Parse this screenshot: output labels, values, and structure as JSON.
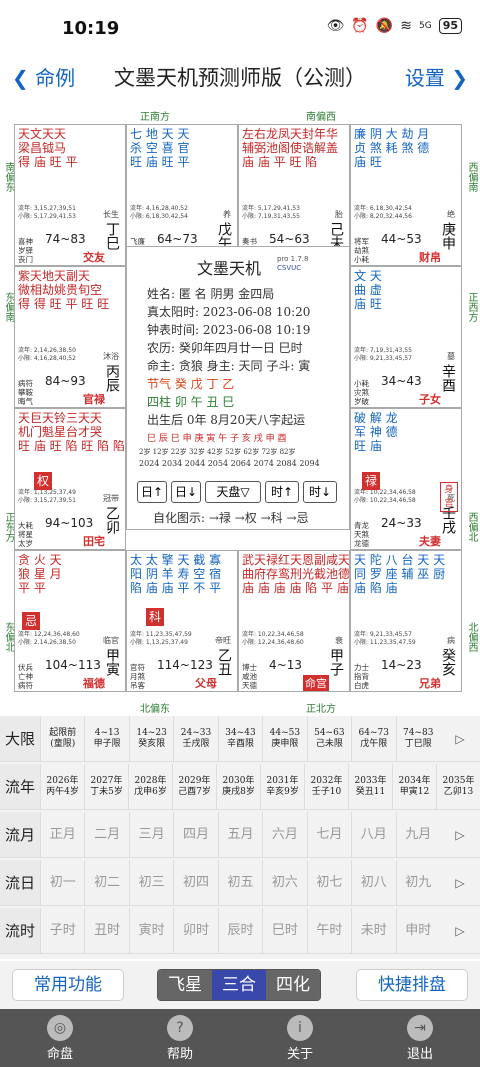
{
  "status": {
    "time": "10:19",
    "battery": "95",
    "net": "5G"
  },
  "nav": {
    "back": "❮ 命例",
    "title": "文墨天机预测师版（公测）",
    "settings": "设置 ❯"
  },
  "dirs": {
    "top1": "正南方",
    "top2": "南偏西",
    "left1": "南偏东",
    "left2": "东偏南",
    "left3": "正东方",
    "left4": "东偏北",
    "right1": "西偏南",
    "right2": "正西方",
    "right3": "西偏北",
    "right4": "北偏西",
    "bot1": "北偏东",
    "bot2": "正北方"
  },
  "cells": [
    {
      "stars": "天文天天\n梁昌钺马\n得 庙 旺 平",
      "minor": "流年: 3,15,27,39,51\n小限: 5,17,29,41,53",
      "yr": "74~83",
      "gz": "丁巳",
      "cs": "长生",
      "gods": "喜神\n岁驿\n丧门",
      "pal": "交友",
      "boxed": false
    },
    {
      "stars": "七 地 天 天\n杀 空 喜 官\n旺 庙 旺 平",
      "minor": "流年: 4,16,28,40,52\n小限: 6,18,30,42,54",
      "yr": "64~73",
      "gz": "戊午",
      "cs": "养",
      "gods": "飞廉\n息神\n贯索",
      "pal": "迁移",
      "boxed": false
    },
    {
      "stars": "左右龙凤天封年华\n辅弼池阁使诰解盖\n庙 庙 平 旺 陷",
      "minor": "流年: 5,17,29,41,53\n小限: 7,19,31,43,55",
      "yr": "54~63",
      "gz": "己未",
      "cs": "胎",
      "gods": "奏书\n华盖\n官符",
      "pal": "疾厄",
      "boxed": false
    },
    {
      "stars": "廉 阴 大 劫 月\n贞 煞 耗 煞 德\n庙 旺",
      "minor": "流年: 6,18,30,42,54\n小限: 8,20,32,44,56",
      "yr": "44~53",
      "gz": "庚申",
      "cs": "绝",
      "gods": "将军\n劫煞\n小耗",
      "pal": "财帛",
      "boxed": false
    },
    {
      "stars": "紫天地天副天\n微相劫姚贵旬空\n得 得 旺 平 旺 旺",
      "minor": "流年: 2,14,26,38,50\n小限: 4,16,28,40,52",
      "yr": "84~93",
      "gz": "丙辰",
      "cs": "沐浴",
      "gods": "病符\n攀鞍\n晦气",
      "pal": "官禄",
      "boxed": false
    },
    {
      "stars": "文 天\n曲 虚\n庙 旺",
      "minor": "流年: 7,19,31,43,55\n小限: 9,21,33,45,57",
      "yr": "34~43",
      "gz": "辛酉",
      "cs": "墓",
      "gods": "小耗\n灾煞\n岁破",
      "pal": "子女",
      "boxed": false
    },
    {
      "stars": "天巨天铃三天天\n机门魁星台才哭\n旺 庙 旺 陷 旺 陷 陷",
      "minor": "流年: 1,13,25,37,49\n小限: 3,15,27,39,51",
      "yr": "94~103",
      "gz": "乙卯",
      "cs": "冠带",
      "gods": "大耗\n将星\n太岁",
      "pal": "田宅",
      "boxed": false
    },
    {
      "stars": "破 解 龙\n军 神 德\n旺 庙",
      "minor": "流年: 10,22,34,46,58\n小限: 10,22,34,46,58",
      "yr": "24~33",
      "gz": "壬戌",
      "cs": "死",
      "gods": "青龙\n天煞\n龙德",
      "pal": "夫妻",
      "boxed": false
    },
    {
      "stars": "贪 火 天\n狼 星 月\n平 平",
      "minor": "流年: 12,24,36,48,60\n小限: 2,14,26,38,50",
      "yr": "104~113",
      "gz": "甲寅",
      "cs": "临官",
      "gods": "伏兵\n亡神\n病符",
      "pal": "福德",
      "boxed": false
    },
    {
      "stars": "太 太 擎 天 截 寡\n阳 阴 羊 寿 空 宿\n陷 庙 庙 平 不 平",
      "minor": "流年: 11,23,35,47,59\n小限: 1,13,25,37,49",
      "yr": "114~123",
      "gz": "乙丑",
      "cs": "帝旺",
      "gods": "官符\n月煞\n吊客",
      "pal": "父母",
      "boxed": false
    },
    {
      "stars": "武天禄红天恩副咸天\n曲府存鸾刑光截池德\n庙 庙 庙 庙 陷 平 庙",
      "minor": "流年: 10,22,34,46,58\n小限: 12,24,36,48,60",
      "yr": "4~13",
      "gz": "甲子",
      "cs": "衰",
      "gods": "博士\n咸池\n天德",
      "pal": "命宫",
      "boxed": true
    },
    {
      "stars": "天 陀 八 台 天 天\n同 罗 座 辅 巫 厨\n庙 陷 庙",
      "minor": "流年: 9,21,33,45,57\n小限: 11,23,35,47,59",
      "yr": "14~23",
      "gz": "癸亥",
      "cs": "病",
      "gods": "力士\n指背\n白虎",
      "pal": "兄弟",
      "boxed": false
    }
  ],
  "badges": {
    "quan": "权",
    "lu": "禄",
    "ke": "科",
    "ji": "忌",
    "shen": "身宫"
  },
  "center": {
    "title": "文墨天机",
    "ver": "pro 1.7.8",
    "code": "CSVUC",
    "l1": "姓名: 匿 名      阴男 金四局",
    "l2": "真太阳时: 2023-06-08 10:20",
    "l3": "钟表时间: 2023-06-08 10:19",
    "l4": "农历: 癸卯年四月廿一日 巳时",
    "l5": "命主: 贪狼 身主: 天同 子斗: 寅",
    "l6": "节气      癸   戊   丁   乙",
    "l7": "四柱      卯   午   丑   巳",
    "l8": "出生后 0年 8月20天八字起运",
    "l9": "巳 辰 巳 申 庚 寅 午 子 亥 戌 申 酉",
    "l10": "2岁 12岁 22岁 32岁 42岁 52岁 62岁 72岁 82岁",
    "l11": "2024 2034 2044 2054 2064 2074 2084 2094",
    "btns": [
      "日↑",
      "日↓",
      "天盘▽",
      "时↑",
      "时↓"
    ],
    "self": "自化图示: →禄 →权 →科 →忌"
  },
  "table": {
    "rows": [
      {
        "h": "大限",
        "cells": [
          "起限前\n(童限)",
          "4~13\n甲子限",
          "14~23\n癸亥限",
          "24~33\n壬戌限",
          "34~43\n辛酉限",
          "44~53\n庚申限",
          "54~63\n己未限",
          "64~73\n戊午限",
          "74~83\n丁巳限"
        ],
        "big": false
      },
      {
        "h": "流年",
        "cells": [
          "2026年\n丙午4岁",
          "2027年\n丁未5岁",
          "2028年\n戊申6岁",
          "2029年\n己酉7岁",
          "2030年\n庚戌8岁",
          "2031年\n辛亥9岁",
          "2032年\n壬子10",
          "2033年\n癸丑11",
          "2034年\n甲寅12",
          "2035年\n乙卯13"
        ],
        "big": false
      },
      {
        "h": "流月",
        "cells": [
          "正月",
          "二月",
          "三月",
          "四月",
          "五月",
          "六月",
          "七月",
          "八月",
          "九月"
        ],
        "big": true
      },
      {
        "h": "流日",
        "cells": [
          "初一",
          "初二",
          "初三",
          "初四",
          "初五",
          "初六",
          "初七",
          "初八",
          "初九"
        ],
        "big": true
      },
      {
        "h": "流时",
        "cells": [
          "子时",
          "丑时",
          "寅时",
          "卯时",
          "辰时",
          "巳时",
          "午时",
          "未时",
          "申时"
        ],
        "big": true
      }
    ],
    "arrow": "▷"
  },
  "btnbar": {
    "common": "常用功能",
    "fly": "飞星",
    "sanhe": "三合",
    "sihua": "四化",
    "quick": "快捷排盘"
  },
  "tabs": [
    {
      "label": "命盘",
      "icon": "◎"
    },
    {
      "label": "帮助",
      "icon": "?"
    },
    {
      "label": "关于",
      "icon": "i"
    },
    {
      "label": "退出",
      "icon": "⇥"
    }
  ]
}
